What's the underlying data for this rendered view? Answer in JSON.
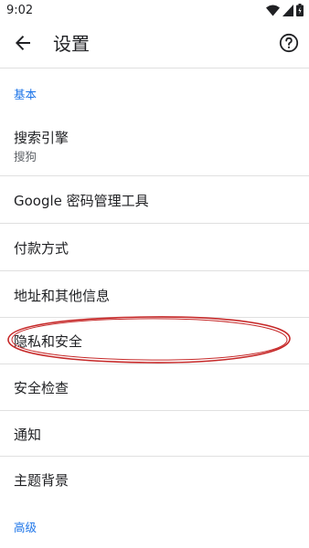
{
  "status_bar": {
    "time": "9:02",
    "icons": [
      "wifi-icon",
      "signal-icon",
      "battery-icon"
    ]
  },
  "app_bar": {
    "title": "设置",
    "back_icon": "arrow-left-icon",
    "help_icon": "help-circle-icon"
  },
  "sections": {
    "basic": "基本",
    "advanced": "高级"
  },
  "rows": {
    "search_engine": {
      "label": "搜索引擎",
      "value": "搜狗"
    },
    "password_manager": {
      "label": "Google 密码管理工具"
    },
    "payment_methods": {
      "label": "付款方式"
    },
    "addresses": {
      "label": "地址和其他信息"
    },
    "privacy_security": {
      "label": "隐私和安全"
    },
    "safety_check": {
      "label": "安全检查"
    },
    "notifications": {
      "label": "通知"
    },
    "themes": {
      "label": "主题背景"
    }
  },
  "colors": {
    "accent": "#1a73e8",
    "annotation": "#c62828",
    "divider": "#e0e0e0"
  }
}
